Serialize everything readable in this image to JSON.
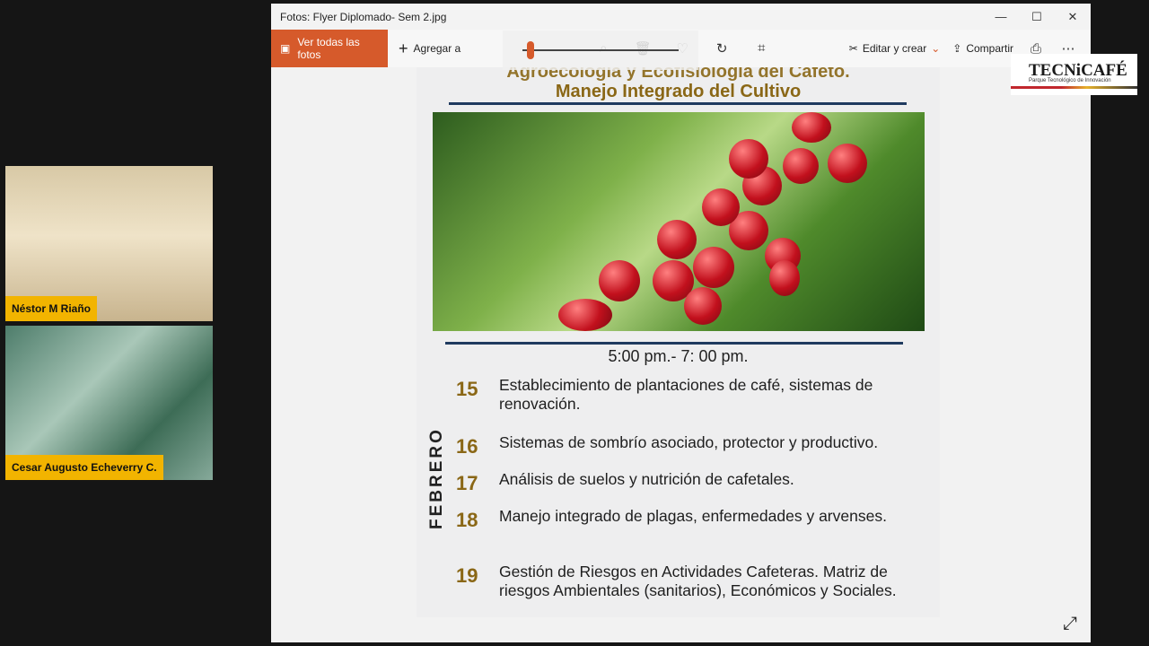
{
  "participants": [
    {
      "name": "Néstor M Riaño"
    },
    {
      "name": "Cesar Augusto Echeverry C."
    }
  ],
  "window": {
    "title": "Fotos: Flyer Diplomado- Sem 2.jpg",
    "controls": {
      "minimize": "—",
      "maximize": "☐",
      "close": "✕"
    }
  },
  "toolbar": {
    "see_all_label": "Ver todas las fotos",
    "add_label": "Agregar a",
    "edit_label": "Editar y crear",
    "share_label": "Compartir"
  },
  "logo": {
    "title": "TECNiCAFÉ",
    "subtitle": "Parque Tecnológico de Innovación"
  },
  "flyer": {
    "heading_line1": "Agroecología y Ecofisiología del Cafeto.",
    "heading_line2": "Manejo Integrado del Cultivo",
    "time": "5:00 pm.- 7: 00 pm.",
    "month": "FEBRERO",
    "sessions": [
      {
        "day": "15",
        "text": "Establecimiento de plantaciones de café, sistemas de renovación."
      },
      {
        "day": "16",
        "text": "Sistemas de sombrío asociado, protector y productivo."
      },
      {
        "day": "17",
        "text": "Análisis de suelos y nutrición de cafetales."
      },
      {
        "day": "18",
        "text": "Manejo integrado de plagas, enfermedades y arvenses."
      },
      {
        "day": "19",
        "text": "Gestión de Riesgos en Actividades Cafeteras. Matriz de riesgos Ambientales (sanitarios), Económicos y Sociales."
      }
    ]
  },
  "zoom_slider": {
    "level": 0.05
  },
  "colors": {
    "accent": "#d65a2b",
    "heading": "#8a6716",
    "rule": "#1f3a5f",
    "name_tag": "#f2b400"
  }
}
